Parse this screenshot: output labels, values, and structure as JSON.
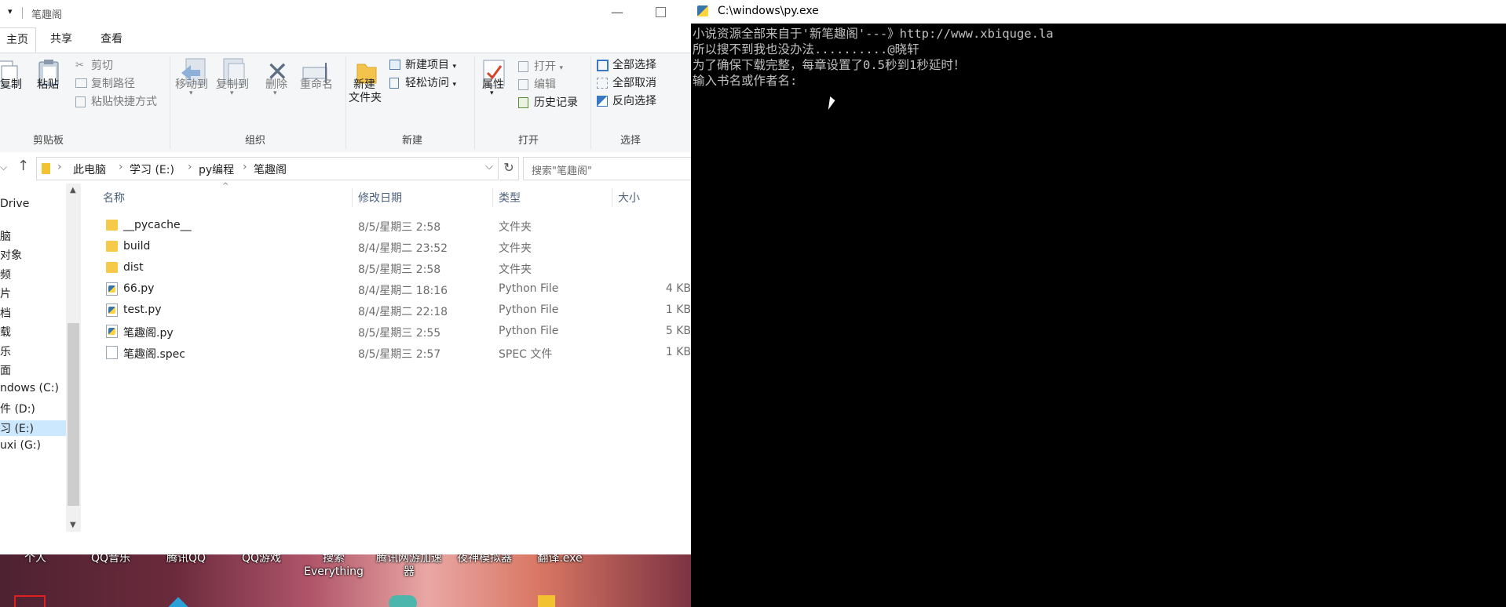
{
  "explorer": {
    "title": "笔趣阁",
    "ribbon_tabs": [
      "主页",
      "共享",
      "查看"
    ],
    "clipboard": {
      "copy": "复制",
      "paste": "粘贴",
      "cut": "剪切",
      "copy_path": "复制路径",
      "paste_shortcut": "粘贴快捷方式",
      "group": "剪贴板"
    },
    "organize": {
      "move_to": "移动到",
      "copy_to": "复制到",
      "delete": "删除",
      "rename": "重命名",
      "group": "组织"
    },
    "new": {
      "new_folder_line1": "新建",
      "new_folder_line2": "文件夹",
      "new_item": "新建项目",
      "easy_access": "轻松访问",
      "group": "新建"
    },
    "open": {
      "properties": "属性",
      "open": "打开",
      "edit": "编辑",
      "history": "历史记录",
      "group": "打开"
    },
    "select": {
      "select_all": "全部选择",
      "select_none": "全部取消",
      "invert": "反向选择",
      "group": "选择"
    },
    "breadcrumb": [
      "此电脑",
      "学习 (E:)",
      "py编程",
      "笔趣阁"
    ],
    "search_placeholder": "搜索\"笔趣阁\"",
    "nav_items": [
      "Drive",
      "脑",
      "对象",
      "频",
      "片",
      "档",
      "载",
      "乐",
      "面",
      "ndows (C:)",
      "件 (D:)",
      "习 (E:)",
      "uxi (G:)"
    ],
    "columns": {
      "name": "名称",
      "date": "修改日期",
      "type": "类型",
      "size": "大小"
    },
    "files": [
      {
        "name": "__pycache__",
        "date": "8/5/星期三 2:58",
        "type": "文件夹",
        "size": "",
        "icon": "folder-icon"
      },
      {
        "name": "build",
        "date": "8/4/星期二 23:52",
        "type": "文件夹",
        "size": "",
        "icon": "folder-icon"
      },
      {
        "name": "dist",
        "date": "8/5/星期三 2:58",
        "type": "文件夹",
        "size": "",
        "icon": "folder-icon"
      },
      {
        "name": "66.py",
        "date": "8/4/星期二 18:16",
        "type": "Python File",
        "size": "4 KB",
        "icon": "python-file-icon"
      },
      {
        "name": "test.py",
        "date": "8/4/星期二 22:18",
        "type": "Python File",
        "size": "1 KB",
        "icon": "python-file-icon"
      },
      {
        "name": "笔趣阁.py",
        "date": "8/5/星期三 2:55",
        "type": "Python File",
        "size": "5 KB",
        "icon": "python-file-icon"
      },
      {
        "name": "笔趣阁.spec",
        "date": "8/5/星期三 2:57",
        "type": "SPEC 文件",
        "size": "1 KB",
        "icon": "spec-file-icon"
      }
    ]
  },
  "desktop": {
    "labels": [
      "个人",
      "QQ音乐",
      "腾讯QQ",
      "QQ游戏",
      "搜索\nEverything",
      "腾讯网游加速\n器",
      "夜神模拟器",
      "翻译.exe"
    ]
  },
  "console": {
    "title": "C:\\windows\\py.exe",
    "lines": [
      "小说资源全部来自于'新笔趣阁'---》http://www.xbiquge.la",
      "所以搜不到我也没办法..........@晓轩",
      "为了确保下载完整，每章设置了0.5秒到1秒延时！",
      "输入书名或作者名:"
    ]
  }
}
